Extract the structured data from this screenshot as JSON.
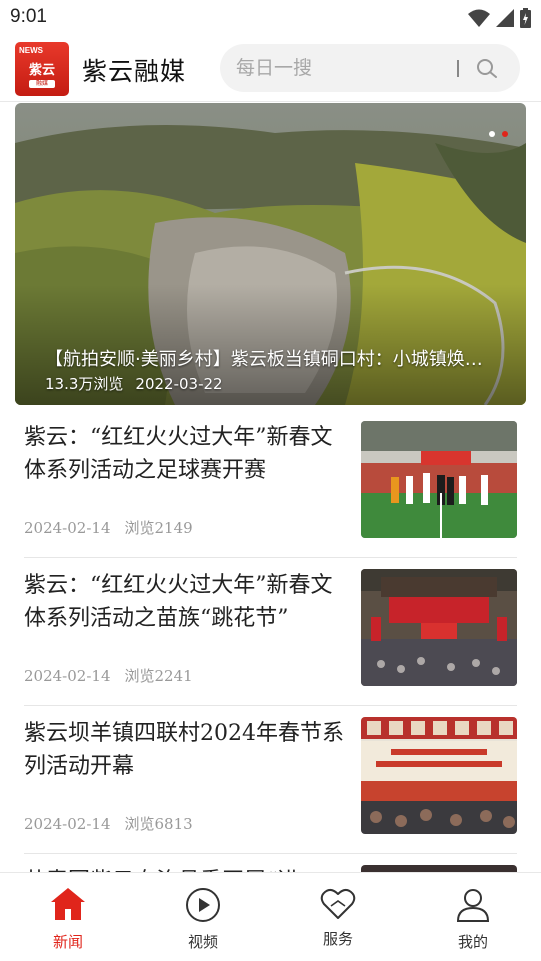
{
  "status_bar": {
    "time": "9:01"
  },
  "header": {
    "logo": {
      "tag": "NEWS",
      "main": "紫云",
      "sub": "融媒"
    },
    "app_title": "紫云融媒",
    "search": {
      "placeholder": "每日一搜"
    }
  },
  "banner": {
    "caption": "【航拍安顺·美丽乡村】紫云板当镇硐口村：小城镇焕新颜",
    "views": "13.3万浏览",
    "date": "2022-03-22",
    "dot_count": 2,
    "active_dot": 1
  },
  "news": [
    {
      "title": "紫云：“红红火火过大年”新春文体系列活动之足球赛开赛",
      "date": "2024-02-14",
      "views": "浏览2149",
      "thumb": "football"
    },
    {
      "title": "紫云：“红红火火过大年”新春文体系列活动之苗族“跳花节”",
      "date": "2024-02-14",
      "views": "浏览2241",
      "thumb": "stage"
    },
    {
      "title": "紫云坝羊镇四联村2024年春节系列活动开幕",
      "date": "2024-02-14",
      "views": "浏览6813",
      "thumb": "banner"
    },
    {
      "title": "共青团紫云自治县委开展“进",
      "date": "",
      "views": "",
      "thumb": "partial"
    }
  ],
  "bottom_nav": [
    {
      "label": "新闻",
      "icon": "home-icon",
      "active": true
    },
    {
      "label": "视频",
      "icon": "play-icon",
      "active": false
    },
    {
      "label": "服务",
      "icon": "heart-icon",
      "active": false
    },
    {
      "label": "我的",
      "icon": "user-icon",
      "active": false
    }
  ],
  "colors": {
    "accent": "#e0251b",
    "logo_red": "#c41c12",
    "text": "#222222",
    "meta": "#999999"
  }
}
